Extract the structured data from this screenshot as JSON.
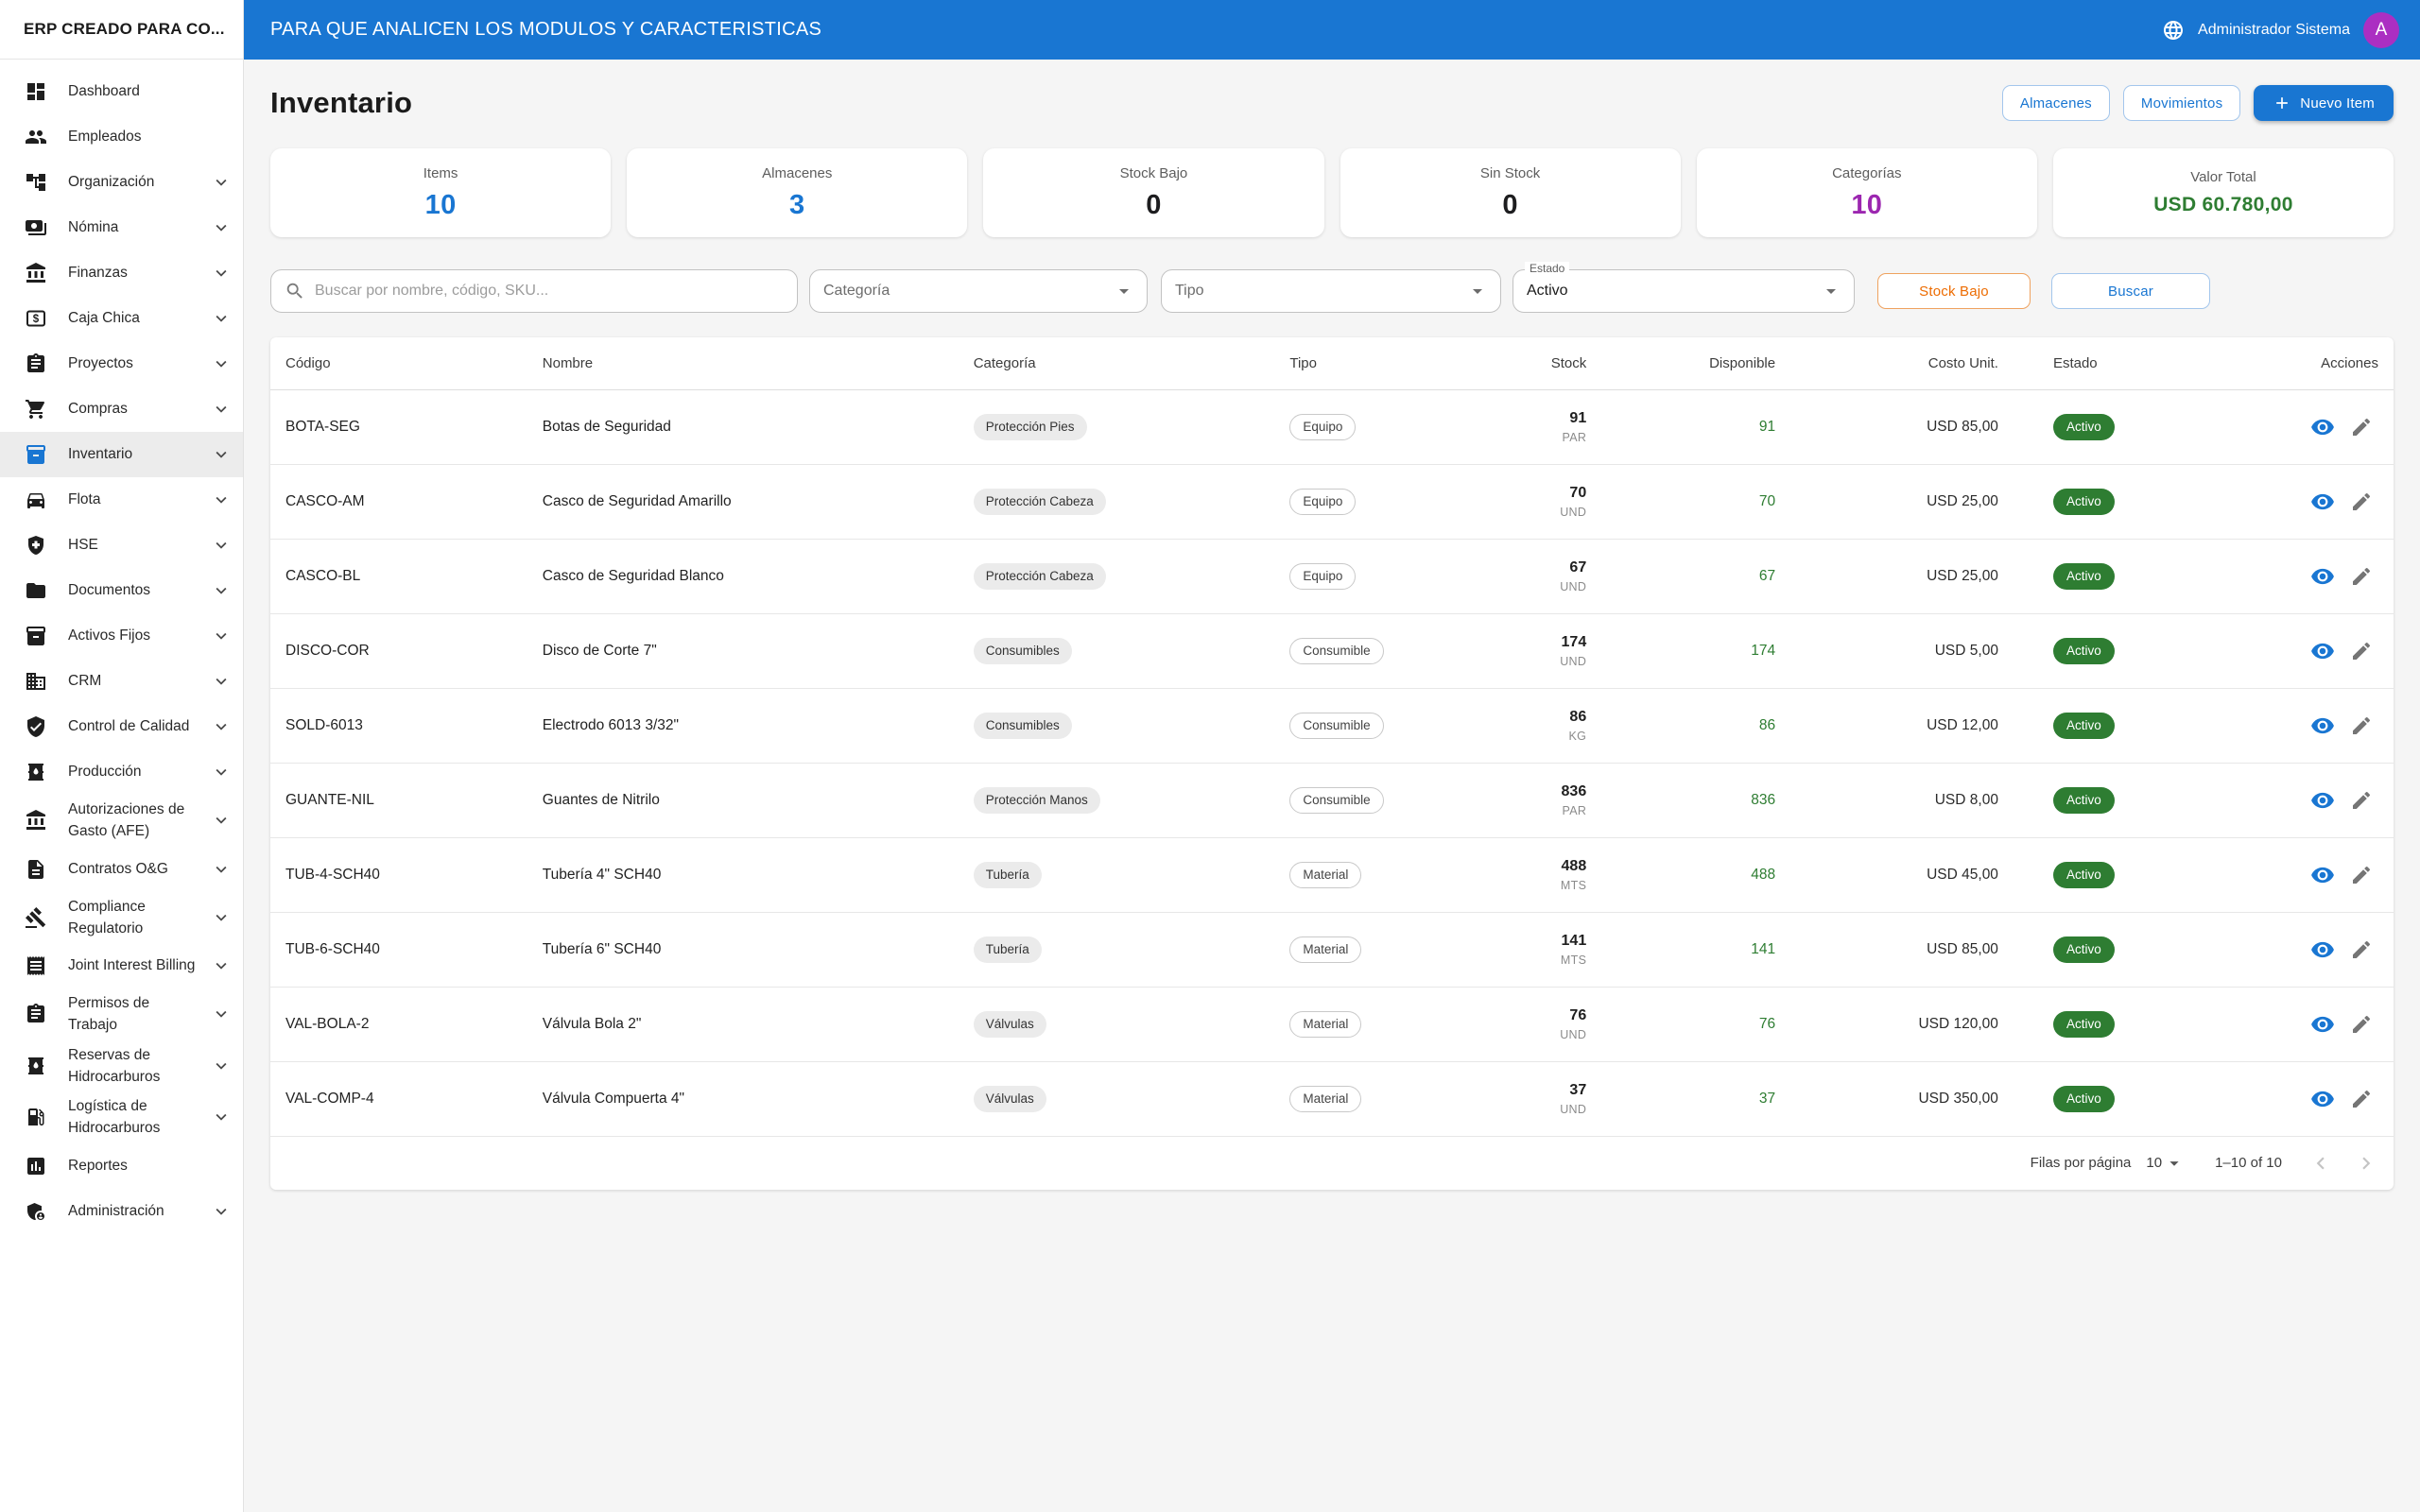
{
  "colors": {
    "primary": "#1976d2",
    "accent_purple": "#9c27b0",
    "success_green": "#2e7d32",
    "warning_orange": "#ed6c02",
    "avatar_purple": "#ab2fc2"
  },
  "sidebar": {
    "title": "ERP CREADO PARA CO...",
    "items": [
      {
        "label": "Dashboard",
        "icon": "dashboard"
      },
      {
        "label": "Empleados",
        "icon": "people"
      },
      {
        "label": "Organización",
        "icon": "org-tree",
        "chevron": true
      },
      {
        "label": "Nómina",
        "icon": "payments",
        "chevron": true
      },
      {
        "label": "Finanzas",
        "icon": "bank",
        "chevron": true
      },
      {
        "label": "Caja Chica",
        "icon": "cash-box",
        "chevron": true
      },
      {
        "label": "Proyectos",
        "icon": "clipboard",
        "chevron": true
      },
      {
        "label": "Compras",
        "icon": "cart",
        "chevron": true
      },
      {
        "label": "Inventario",
        "icon": "inventory",
        "chevron": true,
        "selected": true
      },
      {
        "label": "Flota",
        "icon": "car",
        "chevron": true
      },
      {
        "label": "HSE",
        "icon": "shield-plus",
        "chevron": true
      },
      {
        "label": "Documentos",
        "icon": "folder",
        "chevron": true
      },
      {
        "label": "Activos Fijos",
        "icon": "inventory",
        "chevron": true
      },
      {
        "label": "CRM",
        "icon": "building",
        "chevron": true
      },
      {
        "label": "Control de Calidad",
        "icon": "shield-check",
        "chevron": true
      },
      {
        "label": "Producción",
        "icon": "barrel",
        "chevron": true
      },
      {
        "label": "Autorizaciones de Gasto (AFE)",
        "lines": [
          "Autorizaciones de",
          "Gasto (AFE)"
        ],
        "icon": "bank",
        "chevron": true
      },
      {
        "label": "Contratos O&G",
        "icon": "document",
        "chevron": true
      },
      {
        "label": "Compliance Regulatorio",
        "lines": [
          "Compliance",
          "Regulatorio"
        ],
        "icon": "gavel",
        "chevron": true
      },
      {
        "label": "Joint Interest Billing",
        "icon": "receipt",
        "chevron": true
      },
      {
        "label": "Permisos de Trabajo",
        "lines": [
          "Permisos de",
          "Trabajo"
        ],
        "icon": "clipboard",
        "chevron": true
      },
      {
        "label": "Reservas de Hidrocarburos",
        "lines": [
          "Reservas de",
          "Hidrocarburos"
        ],
        "icon": "barrel",
        "chevron": true
      },
      {
        "label": "Logística de Hidrocarburos",
        "lines": [
          "Logística de",
          "Hidrocarburos"
        ],
        "icon": "gas-pump",
        "chevron": true
      },
      {
        "label": "Reportes",
        "icon": "bar-chart"
      },
      {
        "label": "Administración",
        "icon": "admin",
        "chevron": true
      }
    ]
  },
  "topbar": {
    "title": "PARA QUE ANALICEN LOS MODULOS Y CARACTERISTICAS",
    "user": "Administrador Sistema",
    "avatar_initial": "A"
  },
  "page": {
    "title": "Inventario",
    "buttons": [
      {
        "label": "Almacenes",
        "variant": "outlined"
      },
      {
        "label": "Movimientos",
        "variant": "outlined"
      },
      {
        "label": "Nuevo Item",
        "variant": "contained",
        "icon": "plus"
      }
    ]
  },
  "stats": [
    {
      "label": "Items",
      "value": "10",
      "color": "#1976d2"
    },
    {
      "label": "Almacenes",
      "value": "3",
      "color": "#1976d2"
    },
    {
      "label": "Stock Bajo",
      "value": "0",
      "color": "#1d1d1f"
    },
    {
      "label": "Sin Stock",
      "value": "0",
      "color": "#1d1d1f"
    },
    {
      "label": "Categorías",
      "value": "10",
      "color": "#9c27b0"
    },
    {
      "label": "Valor Total",
      "value": "USD 60.780,00",
      "color": "#2e7d32",
      "compact": true
    }
  ],
  "filters": {
    "search_placeholder": "Buscar por nombre, código, SKU...",
    "category": "Categoría",
    "type": "Tipo",
    "estado_label": "Estado",
    "estado_value": "Activo",
    "low_stock": "Stock Bajo",
    "search_button": "Buscar"
  },
  "table": {
    "headers": [
      "Código",
      "Nombre",
      "Categoría",
      "Tipo",
      "Stock",
      "Disponible",
      "Costo Unit.",
      "Estado",
      "Acciones"
    ],
    "rows": [
      {
        "codigo": "BOTA-SEG",
        "nombre": "Botas de Seguridad",
        "categoria": "Protección Pies",
        "tipo": "Equipo",
        "stock": "91",
        "unidad": "PAR",
        "disponible": "91",
        "costo": "USD 85,00",
        "estado": "Activo"
      },
      {
        "codigo": "CASCO-AM",
        "nombre": "Casco de Seguridad Amarillo",
        "categoria": "Protección Cabeza",
        "tipo": "Equipo",
        "stock": "70",
        "unidad": "UND",
        "disponible": "70",
        "costo": "USD 25,00",
        "estado": "Activo"
      },
      {
        "codigo": "CASCO-BL",
        "nombre": "Casco de Seguridad Blanco",
        "categoria": "Protección Cabeza",
        "tipo": "Equipo",
        "stock": "67",
        "unidad": "UND",
        "disponible": "67",
        "costo": "USD 25,00",
        "estado": "Activo"
      },
      {
        "codigo": "DISCO-COR",
        "nombre": "Disco de Corte 7\"",
        "categoria": "Consumibles",
        "tipo": "Consumible",
        "stock": "174",
        "unidad": "UND",
        "disponible": "174",
        "costo": "USD 5,00",
        "estado": "Activo"
      },
      {
        "codigo": "SOLD-6013",
        "nombre": "Electrodo 6013 3/32\"",
        "categoria": "Consumibles",
        "tipo": "Consumible",
        "stock": "86",
        "unidad": "KG",
        "disponible": "86",
        "costo": "USD 12,00",
        "estado": "Activo"
      },
      {
        "codigo": "GUANTE-NIL",
        "nombre": "Guantes de Nitrilo",
        "categoria": "Protección Manos",
        "tipo": "Consumible",
        "stock": "836",
        "unidad": "PAR",
        "disponible": "836",
        "costo": "USD 8,00",
        "estado": "Activo"
      },
      {
        "codigo": "TUB-4-SCH40",
        "nombre": "Tubería 4\" SCH40",
        "categoria": "Tubería",
        "tipo": "Material",
        "stock": "488",
        "unidad": "MTS",
        "disponible": "488",
        "costo": "USD 45,00",
        "estado": "Activo"
      },
      {
        "codigo": "TUB-6-SCH40",
        "nombre": "Tubería 6\" SCH40",
        "categoria": "Tubería",
        "tipo": "Material",
        "stock": "141",
        "unidad": "MTS",
        "disponible": "141",
        "costo": "USD 85,00",
        "estado": "Activo"
      },
      {
        "codigo": "VAL-BOLA-2",
        "nombre": "Válvula Bola 2\"",
        "categoria": "Válvulas",
        "tipo": "Material",
        "stock": "76",
        "unidad": "UND",
        "disponible": "76",
        "costo": "USD 120,00",
        "estado": "Activo"
      },
      {
        "codigo": "VAL-COMP-4",
        "nombre": "Válvula Compuerta 4\"",
        "categoria": "Válvulas",
        "tipo": "Material",
        "stock": "37",
        "unidad": "UND",
        "disponible": "37",
        "costo": "USD 350,00",
        "estado": "Activo"
      }
    ]
  },
  "pagination": {
    "label": "Filas por página",
    "per_page": "10",
    "range": "1–10 of 10"
  }
}
